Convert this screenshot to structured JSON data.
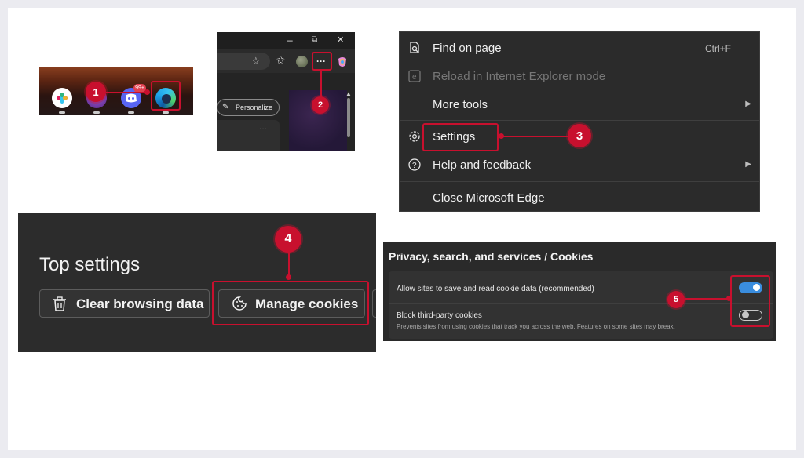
{
  "steps": [
    "1",
    "2",
    "3",
    "4",
    "5"
  ],
  "taskbar": {
    "apps": [
      "slack-icon",
      "app-icon",
      "discord-icon",
      "edge-icon"
    ],
    "notification_badge": "99+"
  },
  "browser": {
    "title_bar": {
      "minimize": "–",
      "restore": "⧉",
      "close": "✕"
    },
    "toolbar": {
      "favorite_icon": "☆",
      "collections_icon": "✩",
      "more_button": "···"
    },
    "personalize_label": "Personalize",
    "card_more": "···"
  },
  "edge_menu": {
    "items": [
      {
        "label": "Find on page",
        "shortcut": "Ctrl+F",
        "icon": "find-icon",
        "enabled": true
      },
      {
        "label": "Reload in Internet Explorer mode",
        "icon": "ie-icon",
        "enabled": false
      },
      {
        "label": "More tools",
        "submenu": true,
        "enabled": true
      },
      {
        "label": "Settings",
        "icon": "gear-icon",
        "enabled": true
      },
      {
        "label": "Help and feedback",
        "icon": "help-icon",
        "submenu": true,
        "enabled": true
      },
      {
        "label": "Close Microsoft Edge",
        "enabled": true
      }
    ],
    "submenu_arrow": "▶"
  },
  "top_settings": {
    "title": "Top settings",
    "clear_browsing": "Clear browsing data",
    "manage_cookies": "Manage cookies"
  },
  "cookies": {
    "breadcrumb": "Privacy, search, and services / Cookies",
    "allow_label": "Allow sites to save and read cookie data (recommended)",
    "allow_on": true,
    "block_label": "Block third-party cookies",
    "block_desc": "Prevents sites from using cookies that track you across the web. Features on some sites may break.",
    "block_on": false
  },
  "colors": {
    "accent": "#c8102e",
    "toggle_on": "#3a8dde"
  }
}
